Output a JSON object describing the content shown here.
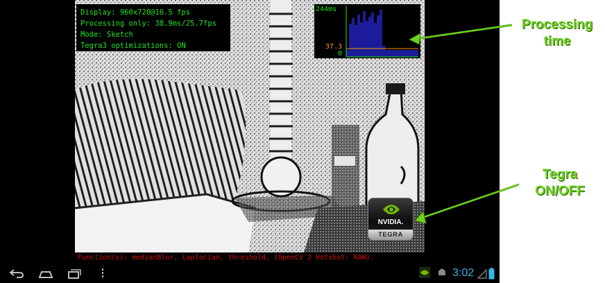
{
  "stats": {
    "display": "Display: 960x720@16.5 fps",
    "processing": "Processing only: 38.9ms/25.7fps",
    "mode": "Mode: Sketch",
    "tegra_opt": "Tegra3 optimizations: ON"
  },
  "graph": {
    "max_label": "244ms",
    "mid_label": "37.3",
    "min_label": "0",
    "colors": {
      "bars": "#1c1c9a",
      "axis": "#22e51f",
      "mid": "#ff9900"
    }
  },
  "tegra_button": {
    "brand": "NVIDIA.",
    "product": "TEGRA"
  },
  "function_text": "Function(s): medianBlur, Laplacian, threshold, (OpenCV 2 Hotshot: RAW).",
  "statusbar": {
    "time": "3:02",
    "icons": [
      "back-icon",
      "home-icon",
      "recent-apps-icon",
      "menu-icon",
      "nvidia-notification-icon",
      "android-debug-icon",
      "signal-icon",
      "battery-icon"
    ]
  },
  "callouts": {
    "processing_time": "Processing time",
    "tegra_toggle": "Tegra ON/OFF",
    "color": "#6dd31f"
  }
}
